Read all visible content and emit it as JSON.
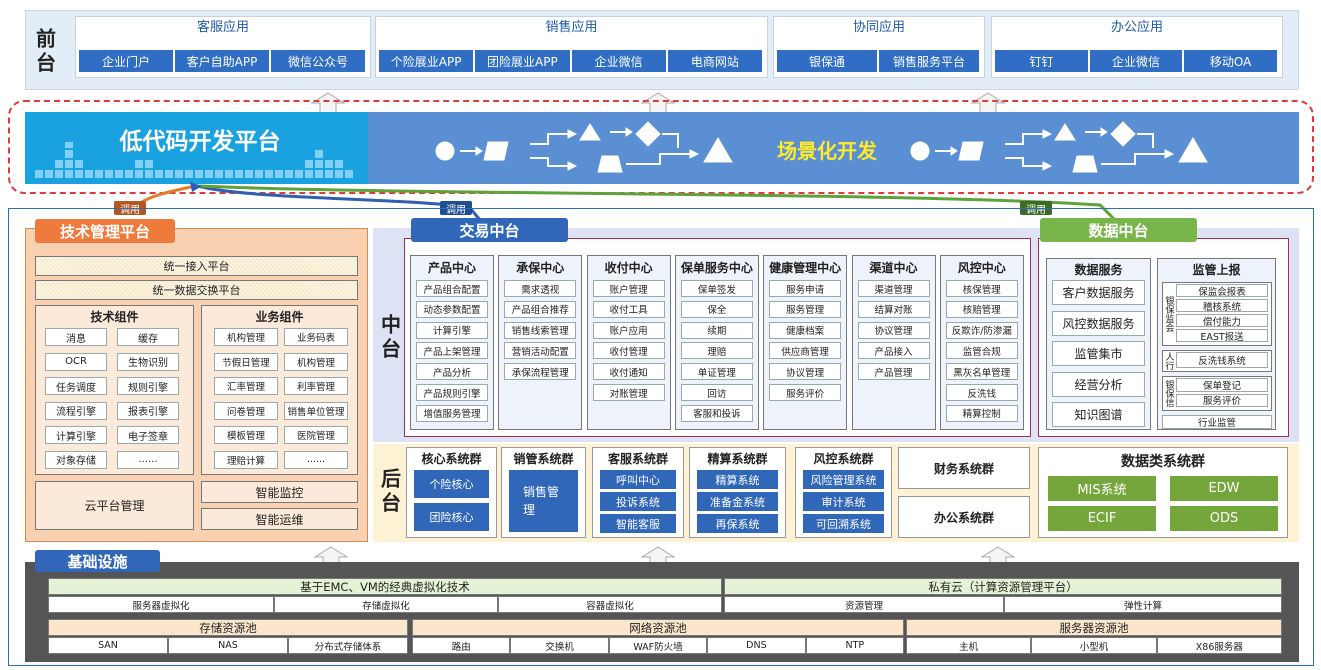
{
  "front": {
    "label": "前台",
    "groups": [
      {
        "title": "客服应用",
        "items": [
          "企业门户",
          "客户自助APP",
          "微信公众号"
        ]
      },
      {
        "title": "销售应用",
        "items": [
          "个险展业APP",
          "团险展业APP",
          "企业微信",
          "电商网站"
        ]
      },
      {
        "title": "协同应用",
        "items": [
          "银保通",
          "销售服务平台"
        ]
      },
      {
        "title": "办公应用",
        "items": [
          "钉钉",
          "企业微信",
          "移动OA"
        ]
      }
    ]
  },
  "lowcode": {
    "title": "低代码开发平台",
    "scene": "场景化开发"
  },
  "call_labels": [
    "调用",
    "调用",
    "调用"
  ],
  "tech": {
    "title": "技术管理平台",
    "top": [
      "统一接入平台",
      "统一数据交换平台"
    ],
    "comp_title": "技术组件",
    "comp": [
      "消息",
      "缓存",
      "OCR",
      "生物识别",
      "任务调度",
      "规则引擎",
      "流程引擎",
      "报表引擎",
      "计算引擎",
      "电子签章",
      "对象存储",
      "......"
    ],
    "biz_title": "业务组件",
    "biz": [
      "机构管理",
      "业务码表",
      "节假日管理",
      "机构管理",
      "汇率管理",
      "利率管理",
      "问卷管理",
      "销售单位管理",
      "模板管理",
      "医院管理",
      "理赔计算",
      "......"
    ],
    "cloud": "云平台管理",
    "monitor": "智能监控",
    "ops": "智能运维"
  },
  "middle": {
    "label": "中台",
    "trade_title": "交易中台",
    "centers": [
      {
        "title": "产品中心",
        "items": [
          "产品组合配置",
          "动态参数配置",
          "计算引擎",
          "产品上架管理",
          "产品分析",
          "产品规则引擎",
          "增值服务管理"
        ]
      },
      {
        "title": "承保中心",
        "items": [
          "需求透视",
          "产品组合推荐",
          "销售线索管理",
          "营销活动配置",
          "承保流程管理"
        ]
      },
      {
        "title": "收付中心",
        "items": [
          "账户管理",
          "收付工具",
          "账户应用",
          "收付管理",
          "收付通知",
          "对账管理"
        ]
      },
      {
        "title": "保单服务中心",
        "items": [
          "保单签发",
          "保全",
          "续期",
          "理赔",
          "单证管理",
          "回访",
          "客服和投诉"
        ]
      },
      {
        "title": "健康管理中心",
        "items": [
          "服务申请",
          "服务管理",
          "健康档案",
          "供应商管理",
          "协议管理",
          "服务评价"
        ]
      },
      {
        "title": "渠道中心",
        "items": [
          "渠道管理",
          "结算对账",
          "协议管理",
          "产品接入",
          "产品管理"
        ]
      },
      {
        "title": "风控中心",
        "items": [
          "核保管理",
          "核赔管理",
          "反欺诈/防渗漏",
          "监管合规",
          "黑灰名单管理",
          "反洗钱",
          "精算控制"
        ]
      }
    ],
    "data_title": "数据中台",
    "data_svc_title": "数据服务",
    "data_svc": [
      "客户数据服务",
      "风控数据服务",
      "监管集市",
      "经营分析",
      "知识图谱"
    ],
    "reg_title": "监管上报",
    "reg_groups": [
      {
        "side": "银保监会",
        "items": [
          "保监会报表",
          "稽核系统",
          "偿付能力",
          "EAST报送"
        ]
      },
      {
        "side": "人行",
        "items": [
          "反洗钱系统"
        ]
      },
      {
        "side": "银保信",
        "items": [
          "保单登记",
          "服务评价"
        ]
      }
    ],
    "reg_last": "行业监管"
  },
  "back": {
    "label": "后台",
    "clusters": [
      {
        "title": "核心系统群",
        "items": [
          "个险核心",
          "团险核心"
        ]
      },
      {
        "title": "销管系统群",
        "items": [
          "销售管理"
        ]
      },
      {
        "title": "客服系统群",
        "items": [
          "呼叫中心",
          "投诉系统",
          "智能客服"
        ]
      },
      {
        "title": "精算系统群",
        "items": [
          "精算系统",
          "准备金系统",
          "再保系统"
        ]
      },
      {
        "title": "风控系统群",
        "items": [
          "风险管理系统",
          "审计系统",
          "可回溯系统"
        ]
      }
    ],
    "finance": "财务系统群",
    "office": "办公系统群",
    "data_cluster": "数据类系统群",
    "data_items": [
      "MIS系统",
      "EDW",
      "ECIF",
      "ODS"
    ]
  },
  "infra": {
    "title": "基础设施",
    "virt": "基于EMC、VM的经典虚拟化技术",
    "virt_items": [
      "服务器虚拟化",
      "存储虚拟化",
      "容器虚拟化"
    ],
    "cloud": "私有云（计算资源管理平台）",
    "cloud_items": [
      "资源管理",
      "弹性计算"
    ],
    "pools": [
      {
        "title": "存储资源池",
        "items": [
          "SAN",
          "NAS",
          "分布式存储体系"
        ]
      },
      {
        "title": "网络资源池",
        "items": [
          "路由",
          "交换机",
          "WAF防火墙",
          "DNS",
          "NTP"
        ]
      },
      {
        "title": "服务器资源池",
        "items": [
          "主机",
          "小型机",
          "X86服务器"
        ]
      }
    ]
  },
  "colors": {
    "blue": "#2f6ec4",
    "orange": "#f08a4b",
    "green": "#78b54a",
    "bg": "#eaf1fb"
  }
}
